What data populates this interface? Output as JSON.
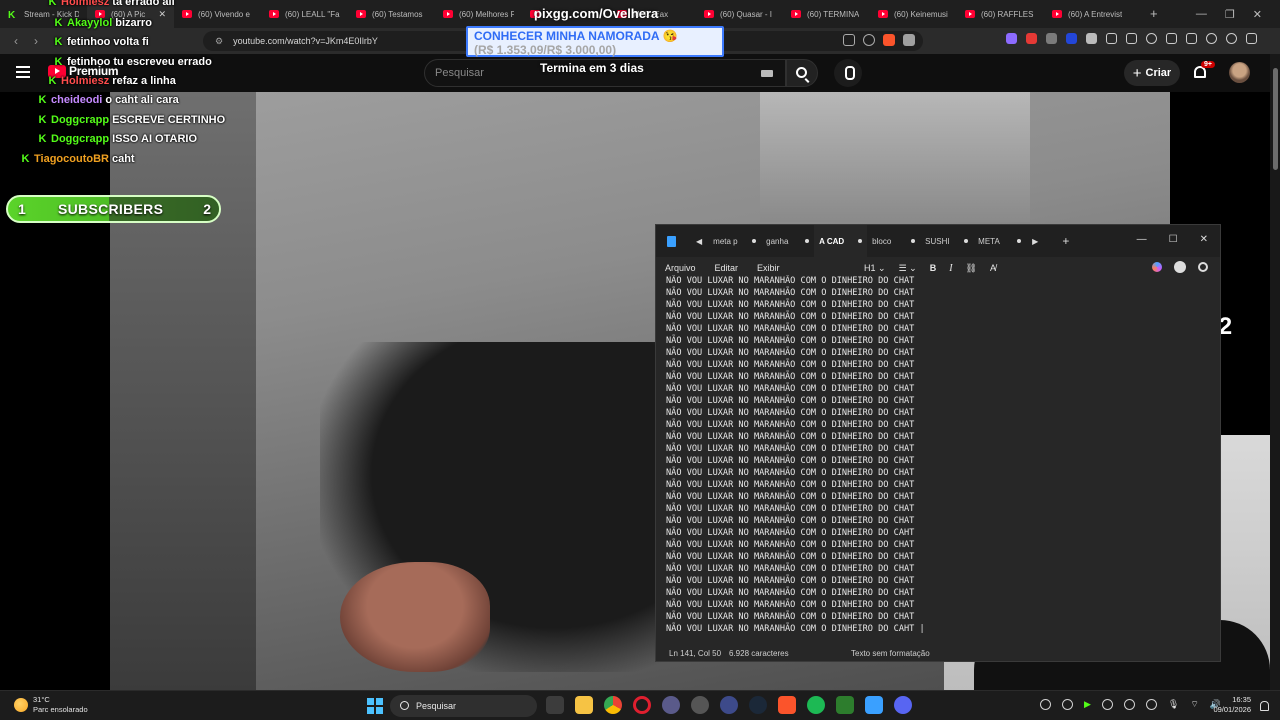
{
  "browser": {
    "tabs": [
      {
        "title": "Stream - Kick D",
        "icon": "kick-icon"
      },
      {
        "title": "(60) A Pic",
        "icon": "youtube-icon"
      },
      {
        "title": "(60) Vivendo e",
        "icon": "youtube-icon"
      },
      {
        "title": "(60) LEALL \"Fa",
        "icon": "youtube-icon"
      },
      {
        "title": "(60) Testamos",
        "icon": "youtube-icon"
      },
      {
        "title": "(60) Melhores F",
        "icon": "youtube-icon"
      },
      {
        "title": "",
        "icon": "youtube-icon"
      },
      {
        "title": "M. C. Eax",
        "icon": "youtube-icon"
      },
      {
        "title": "(60) Quasar - I",
        "icon": "youtube-icon"
      },
      {
        "title": "(60) TERMINA",
        "icon": "youtube-icon"
      },
      {
        "title": "(60) Keinemusi",
        "icon": "youtube-icon"
      },
      {
        "title": "(60) RAFFLES D",
        "icon": "youtube-icon"
      },
      {
        "title": "(60) A Entrevist",
        "icon": "youtube-icon"
      }
    ],
    "url": "youtube.com/watch?v=JKm4E0IlrbY"
  },
  "youtube": {
    "logo_text": "Premium",
    "search_placeholder": "Pesquisar",
    "create_label": "Criar",
    "notifications_badge": "9+"
  },
  "overlay": {
    "pix_title": "pixgg.com/Ovelhera",
    "pix_goal_title": "CONHECER MINHA NAMORADA 😘",
    "pix_goal_amount": "(R$ 1.353,09/R$ 3.000,00)",
    "timer": "Termina em 3 dias",
    "sub_start": "1",
    "sub_label": "SUBSCRIBERS",
    "sub_goal": "2",
    "viewer_count": "212"
  },
  "chat": [
    {
      "user": "Holmiesz",
      "message": "ta errado ali",
      "color": "#ff4d4d"
    },
    {
      "user": "Akayylol",
      "message": "bizarro",
      "color": "#53fc18"
    },
    {
      "user": "fetinhoo",
      "message": "volta fi",
      "color": "#ffffff"
    },
    {
      "user": "fetinhoo",
      "message": "tu escreveu errado",
      "color": "#ffffff"
    },
    {
      "user": "Holmiesz",
      "message": "refaz a linha",
      "color": "#ff4d4d"
    },
    {
      "user": "cheideodi",
      "message": "o caht ali cara",
      "color": "#c58aff"
    },
    {
      "user": "Doggcrapp",
      "message": "ESCREVE CERTINHO",
      "color": "#53fc18"
    },
    {
      "user": "Doggcrapp",
      "message": "ISSO AI OTARIO",
      "color": "#53fc18"
    },
    {
      "user": "TiagocoutoBR",
      "message": "caht",
      "color": "#f0a020"
    }
  ],
  "notepad": {
    "tabs": [
      "meta p",
      "ganha",
      "A CAD",
      "bloco",
      "SUSHI",
      "META"
    ],
    "active_tab": "A CAD",
    "menu": [
      "Arquivo",
      "Editar",
      "Exibir"
    ],
    "heading_select": "H1",
    "lines": [
      "NÃO VOU LUXAR NO MARANHÃO COM O DINHEIRO DO CHAT",
      "NÃO VOU LUXAR NO MARANHÃO COM O DINHEIRO DO CHAT",
      "NÃO VOU LUXAR NO MARANHÃO COM O DINHEIRO DO CHAT",
      "NÃO VOU LUXAR NO MARANHÃO COM O DINHEIRO DO CHAT",
      "NÃO VOU LUXAR NO MARANHÃO COM O DINHEIRO DO CHAT",
      "NÃO VOU LUXAR NO MARANHÃO COM O DINHEIRO DO CHAT",
      "NÃO VOU LUXAR NO MARANHÃO COM O DINHEIRO DO CHAT",
      "NÃO VOU LUXAR NO MARANHÃO COM O DINHEIRO DO CHAT",
      "NÃO VOU LUXAR NO MARANHÃO COM O DINHEIRO DO CHAT",
      "NÃO VOU LUXAR NO MARANHÃO COM O DINHEIRO DO CHAT",
      "NÃO VOU LUXAR NO MARANHÃO COM O DINHEIRO DO CHAT",
      "NÃO VOU LUXAR NO MARANHÃO COM O DINHEIRO DO CHAT",
      "NÃO VOU LUXAR NO MARANHÃO COM O DINHEIRO DO CHAT",
      "NÃO VOU LUXAR NO MARANHÃO COM O DINHEIRO DO CHAT",
      "NÃO VOU LUXAR NO MARANHÃO COM O DINHEIRO DO CHAT",
      "NÃO VOU LUXAR NO MARANHÃO COM O DINHEIRO DO CHAT",
      "NÃO VOU LUXAR NO MARANHÃO COM O DINHEIRO DO CHAT",
      "NÃO VOU LUXAR NO MARANHÃO COM O DINHEIRO DO CHAT",
      "NÃO VOU LUXAR NO MARANHÃO COM O DINHEIRO DO CHAT",
      "NÃO VOU LUXAR NO MARANHÃO COM O DINHEIRO DO CHAT",
      "NÃO VOU LUXAR NO MARANHÃO COM O DINHEIRO DO CHAT",
      "NÃO VOU LUXAR NO MARANHÃO COM O DINHEIRO DO CAHT",
      "NÃO VOU LUXAR NO MARANHÃO COM O DINHEIRO DO CHAT",
      "NÃO VOU LUXAR NO MARANHÃO COM O DINHEIRO DO CHAT",
      "NÃO VOU LUXAR NO MARANHÃO COM O DINHEIRO DO CHAT",
      "NÃO VOU LUXAR NO MARANHÃO COM O DINHEIRO DO CHAT",
      "NÃO VOU LUXAR NO MARANHÃO COM O DINHEIRO DO CHAT",
      "NÃO VOU LUXAR NO MARANHÃO COM O DINHEIRO DO CHAT",
      "NÃO VOU LUXAR NO MARANHÃO COM O DINHEIRO DO CHAT",
      "NÃO VOU LUXAR NO MARANHÃO COM O DINHEIRO DO CAHT |"
    ],
    "status_position": "Ln 141, Col 50",
    "status_chars": "6.928 caracteres",
    "status_format": "Texto sem formatação"
  },
  "taskbar": {
    "temperature": "31°C",
    "weather": "Parc ensolarado",
    "search_placeholder": "Pesquisar",
    "time": "16:35",
    "date": "09/01/2026"
  },
  "colors": {
    "kick_green": "#53fc18",
    "twitch_purple": "#9146ff",
    "youtube_red": "#ff0033",
    "pix_blue": "#2f6cf5"
  }
}
